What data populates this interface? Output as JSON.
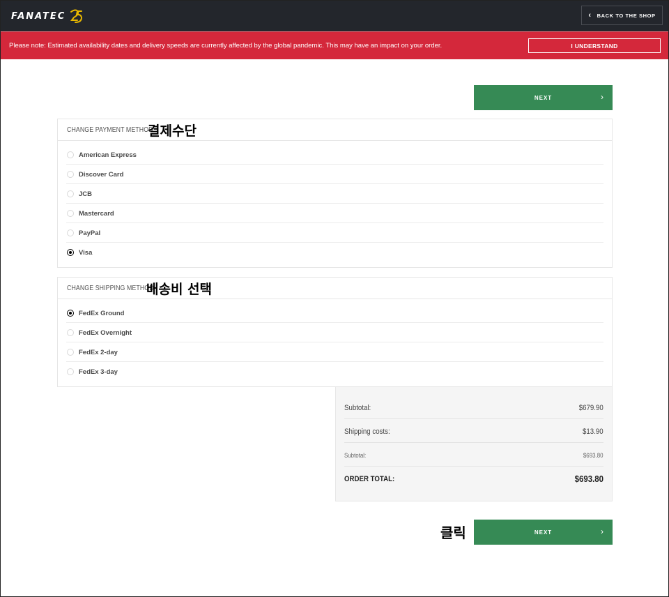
{
  "header": {
    "logo_text": "FANATEC",
    "back_label": "BACK TO THE SHOP"
  },
  "banner": {
    "message": "Please note: Estimated availability dates and delivery speeds are currently affected by the global pandemic. This may have an impact on your order.",
    "understand_label": "I UNDERSTAND"
  },
  "next_label": "NEXT",
  "payment": {
    "title": "CHANGE PAYMENT METHOD",
    "annotation": "결제수단",
    "options": [
      {
        "label": "American Express",
        "checked": false
      },
      {
        "label": "Discover Card",
        "checked": false
      },
      {
        "label": "JCB",
        "checked": false
      },
      {
        "label": "Mastercard",
        "checked": false
      },
      {
        "label": "PayPal",
        "checked": false
      },
      {
        "label": "Visa",
        "checked": true
      }
    ]
  },
  "shipping": {
    "title": "CHANGE SHIPPING METHOD",
    "annotation": "배송비 선택",
    "options": [
      {
        "label": "FedEx Ground",
        "checked": true
      },
      {
        "label": "FedEx Overnight",
        "checked": false
      },
      {
        "label": "FedEx 2-day",
        "checked": false
      },
      {
        "label": "FedEx 3-day",
        "checked": false
      }
    ]
  },
  "summary": {
    "subtotal_label": "Subtotal:",
    "subtotal_value": "$679.90",
    "shipping_label": "Shipping costs:",
    "shipping_value": "$13.90",
    "subtotal2_label": "Subtotal:",
    "subtotal2_value": "$693.80",
    "total_label": "ORDER TOTAL:",
    "total_value": "$693.80"
  },
  "click_annotation": "클릭",
  "colors": {
    "topbar": "#23262c",
    "banner": "#d4283b",
    "next_button": "#368a55",
    "logo_accent": "#e8b800"
  }
}
